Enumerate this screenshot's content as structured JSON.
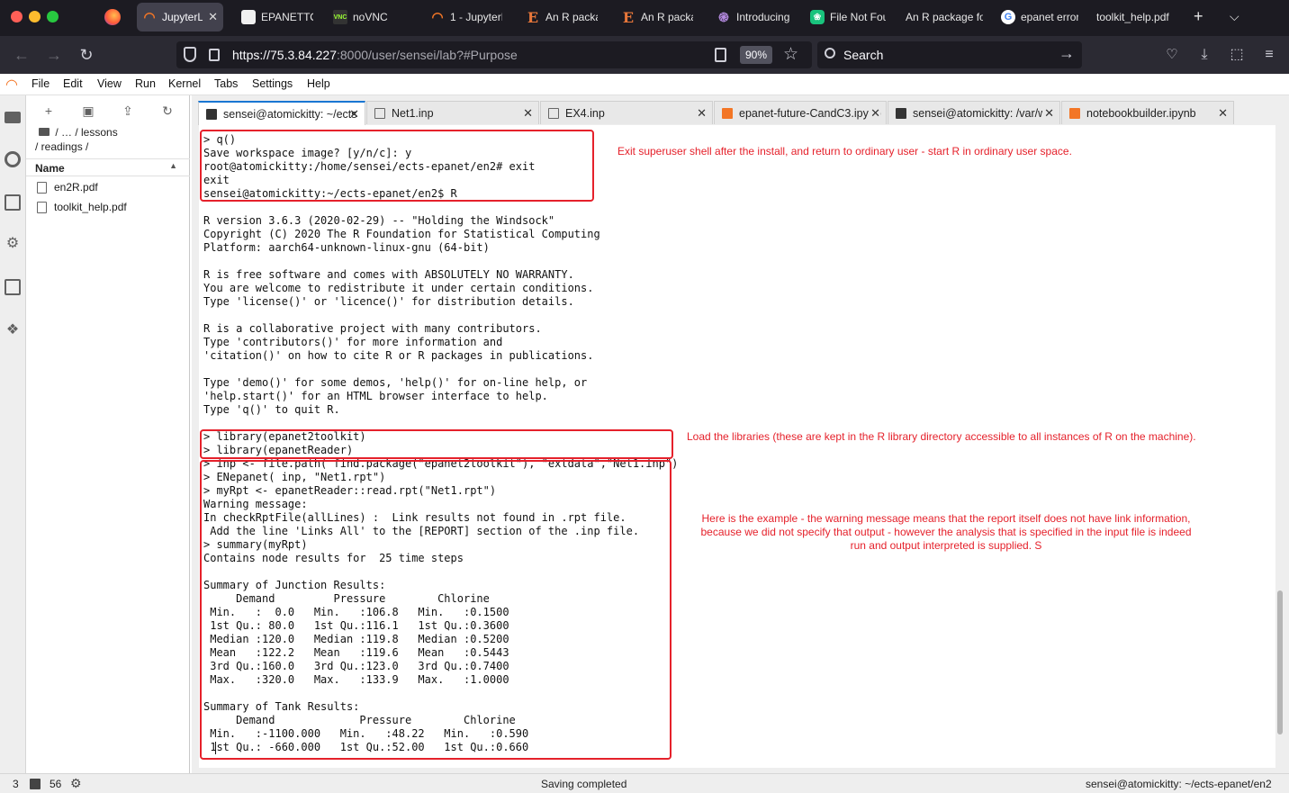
{
  "browser": {
    "tabs": [
      {
        "label": "JupyterLab",
        "icon": "jupyter-icon",
        "active": true
      },
      {
        "label": "EPANETTOOLS",
        "icon": "cube-icon"
      },
      {
        "label": "noVNC",
        "icon": "vnc-icon"
      },
      {
        "label": "1 - JupyterLab",
        "icon": "jupyter-icon"
      },
      {
        "label": "An R package",
        "icon": "e-icon"
      },
      {
        "label": "An R package",
        "icon": "e-icon"
      },
      {
        "label": "Introducing",
        "icon": "spiral-icon"
      },
      {
        "label": "File Not Found",
        "icon": "openai-icon"
      },
      {
        "label": "An R package fo",
        "icon": "none"
      },
      {
        "label": "epanet error",
        "icon": "google-icon"
      },
      {
        "label": "toolkit_help.pdf",
        "icon": "none"
      }
    ],
    "url_host": "https://75.3.84.227",
    "url_rest": ":8000/user/sensei/lab?#Purpose",
    "zoom": "90%",
    "search_placeholder": "Search"
  },
  "jupyter_menu": [
    "File",
    "Edit",
    "View",
    "Run",
    "Kernel",
    "Tabs",
    "Settings",
    "Help"
  ],
  "filebrowser": {
    "breadcrumb_line1": "/   …   / lessons",
    "breadcrumb_line2": "/ readings /",
    "column_name": "Name",
    "files": [
      "en2R.pdf",
      "toolkit_help.pdf"
    ]
  },
  "dock_tabs": [
    {
      "label": "sensei@atomickitty: ~/ects",
      "icon": "terminal-icon",
      "active": true
    },
    {
      "label": "Net1.inp",
      "icon": "file-icon"
    },
    {
      "label": "EX4.inp",
      "icon": "file-icon"
    },
    {
      "label": "epanet-future-CandC3.ipynb",
      "icon": "notebook-icon"
    },
    {
      "label": "sensei@atomickitty: /var/w",
      "icon": "terminal-icon"
    },
    {
      "label": "notebookbuilder.ipynb",
      "icon": "notebook-icon"
    }
  ],
  "terminal": {
    "lines": "> q()\nSave workspace image? [y/n/c]: y\nroot@atomickitty:/home/sensei/ects-epanet/en2# exit\nexit\nsensei@atomickitty:~/ects-epanet/en2$ R\n\nR version 3.6.3 (2020-02-29) -- \"Holding the Windsock\"\nCopyright (C) 2020 The R Foundation for Statistical Computing\nPlatform: aarch64-unknown-linux-gnu (64-bit)\n\nR is free software and comes with ABSOLUTELY NO WARRANTY.\nYou are welcome to redistribute it under certain conditions.\nType 'license()' or 'licence()' for distribution details.\n\nR is a collaborative project with many contributors.\nType 'contributors()' for more information and\n'citation()' on how to cite R or R packages in publications.\n\nType 'demo()' for some demos, 'help()' for on-line help, or\n'help.start()' for an HTML browser interface to help.\nType 'q()' to quit R.\n\n> library(epanet2toolkit)\n> library(epanetReader)\n> inp <- file.path( find.package(\"epanet2toolkit\"), \"extdata\",\"Net1.inp\")\n> ENepanet( inp, \"Net1.rpt\")\n> myRpt <- epanetReader::read.rpt(\"Net1.rpt\")\nWarning message:\nIn checkRptFile(allLines) :  Link results not found in .rpt file.\n Add the line 'Links All' to the [REPORT] section of the .inp file.\n> summary(myRpt)\nContains node results for  25 time steps\n\nSummary of Junction Results:\n     Demand         Pressure        Chlorine\n Min.   :  0.0   Min.   :106.8   Min.   :0.1500\n 1st Qu.: 80.0   1st Qu.:116.1   1st Qu.:0.3600\n Median :120.0   Median :119.8   Median :0.5200\n Mean   :122.2   Mean   :119.6   Mean   :0.5443\n 3rd Qu.:160.0   3rd Qu.:123.0   3rd Qu.:0.7400\n Max.   :320.0   Max.   :133.9   Max.   :1.0000\n\nSummary of Tank Results:\n     Demand             Pressure        Chlorine\n Min.   :-1100.000   Min.   :48.22   Min.   :0.590\n 1st Qu.: -660.000   1st Qu.:52.00   1st Qu.:0.660"
  },
  "annotations": {
    "exit_note": "Exit superuser shell after the install, and return to ordinary user - start R in ordinary user space.",
    "library_note": "Load the libraries (these are kept in the R library directory accessible to all instances of R on the machine).",
    "example_note_1": "Here is the example - the warning message means that the report itself does not have link information,",
    "example_note_2": "because we did not specify that output - however the analysis that is specified in the input file is indeed",
    "example_note_3": "run and output interpreted is supplied.  S"
  },
  "statusbar": {
    "count_a": "3",
    "count_b": "56",
    "message": "Saving completed",
    "terminal_path": "sensei@atomickitty: ~/ects-epanet/en2"
  },
  "colors": {
    "annotation_red": "#e5212b",
    "active_tab_accent": "#1976d2",
    "jupyter_orange": "#f37626"
  }
}
